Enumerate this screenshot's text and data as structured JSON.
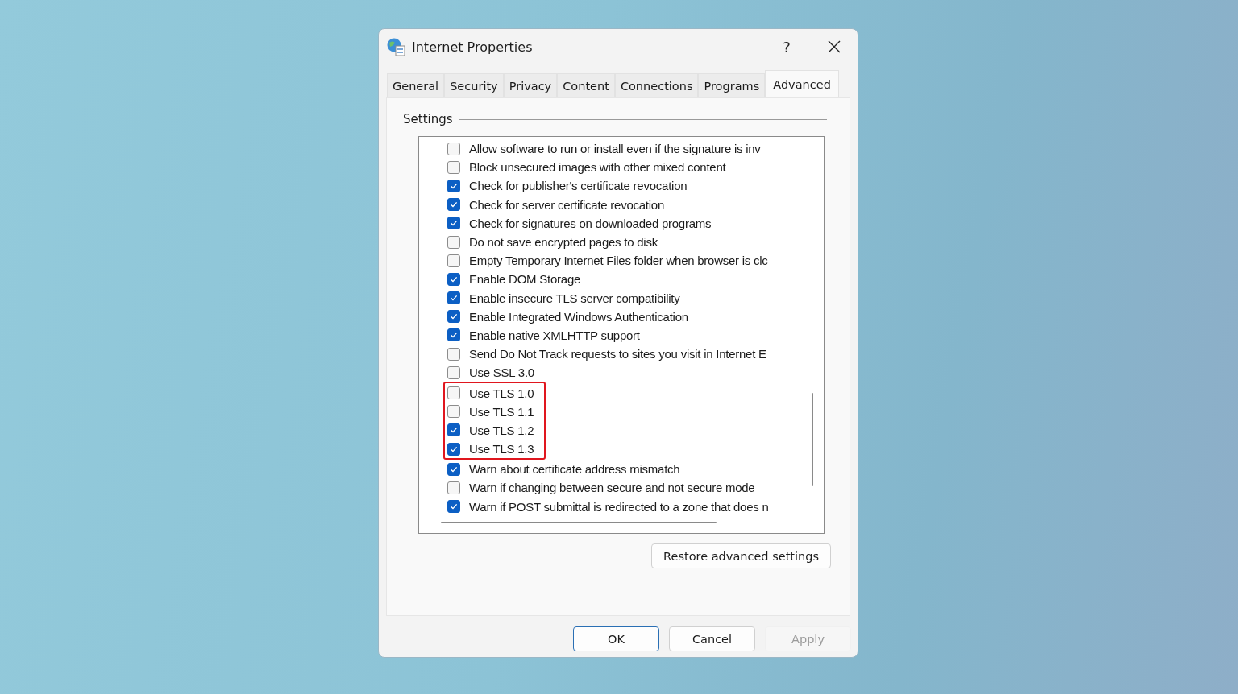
{
  "window": {
    "title": "Internet Properties",
    "help": "?"
  },
  "tabs": [
    {
      "label": "General",
      "selected": false
    },
    {
      "label": "Security",
      "selected": false
    },
    {
      "label": "Privacy",
      "selected": false
    },
    {
      "label": "Content",
      "selected": false
    },
    {
      "label": "Connections",
      "selected": false
    },
    {
      "label": "Programs",
      "selected": false
    },
    {
      "label": "Advanced",
      "selected": true
    }
  ],
  "settings": {
    "label": "Settings",
    "items": [
      {
        "label": "Allow software to run or install even if the signature is inv",
        "checked": false,
        "highlighted": false
      },
      {
        "label": "Block unsecured images with other mixed content",
        "checked": false,
        "highlighted": false
      },
      {
        "label": "Check for publisher's certificate revocation",
        "checked": true,
        "highlighted": false
      },
      {
        "label": "Check for server certificate revocation",
        "checked": true,
        "highlighted": false
      },
      {
        "label": "Check for signatures on downloaded programs",
        "checked": true,
        "highlighted": false
      },
      {
        "label": "Do not save encrypted pages to disk",
        "checked": false,
        "highlighted": false
      },
      {
        "label": "Empty Temporary Internet Files folder when browser is clc",
        "checked": false,
        "highlighted": false
      },
      {
        "label": "Enable DOM Storage",
        "checked": true,
        "highlighted": false
      },
      {
        "label": "Enable insecure TLS server compatibility",
        "checked": true,
        "highlighted": false
      },
      {
        "label": "Enable Integrated Windows Authentication",
        "checked": true,
        "highlighted": false
      },
      {
        "label": "Enable native XMLHTTP support",
        "checked": true,
        "highlighted": false
      },
      {
        "label": "Send Do Not Track requests to sites you visit in Internet E",
        "checked": false,
        "highlighted": false
      },
      {
        "label": "Use SSL 3.0",
        "checked": false,
        "highlighted": false
      },
      {
        "label": "Use TLS 1.0",
        "checked": false,
        "highlighted": true
      },
      {
        "label": "Use TLS 1.1",
        "checked": false,
        "highlighted": true
      },
      {
        "label": "Use TLS 1.2",
        "checked": true,
        "highlighted": true
      },
      {
        "label": "Use TLS 1.3",
        "checked": true,
        "highlighted": true
      },
      {
        "label": "Warn about certificate address mismatch",
        "checked": true,
        "highlighted": false
      },
      {
        "label": "Warn if changing between secure and not secure mode",
        "checked": false,
        "highlighted": false
      },
      {
        "label": "Warn if POST submittal is redirected to a zone that does n",
        "checked": true,
        "highlighted": false
      }
    ],
    "restore_button": "Restore advanced settings"
  },
  "buttons": [
    {
      "label": "OK",
      "default": true,
      "disabled": false
    },
    {
      "label": "Cancel",
      "default": false,
      "disabled": false
    },
    {
      "label": "Apply",
      "default": false,
      "disabled": true
    }
  ]
}
